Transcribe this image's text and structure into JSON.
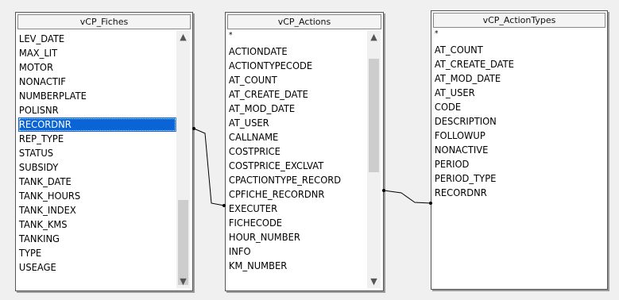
{
  "tables": [
    {
      "title": "vCP_Fiches",
      "fields": [
        "LEV_DATE",
        "MAX_LIT",
        "MOTOR",
        "NONACTIF",
        "NUMBERPLATE",
        "POLISNR",
        "RECORDNR",
        "REP_TYPE",
        "STATUS",
        "SUBSIDY",
        "TANK_DATE",
        "TANK_HOURS",
        "TANK_INDEX",
        "TANK_KMS",
        "TANKING",
        "TYPE",
        "USEAGE"
      ],
      "selected": "RECORDNR"
    },
    {
      "title": "vCP_Actions",
      "fields": [
        "*",
        "ACTIONDATE",
        "ACTIONTYPECODE",
        "AT_COUNT",
        "AT_CREATE_DATE",
        "AT_MOD_DATE",
        "AT_USER",
        "CALLNAME",
        "COSTPRICE",
        "COSTPRICE_EXCLVAT",
        "CPACTIONTYPE_RECORD",
        "CPFICHE_RECORDNR",
        "EXECUTER",
        "FICHECODE",
        "HOUR_NUMBER",
        "INFO",
        "KM_NUMBER"
      ]
    },
    {
      "title": "vCP_ActionTypes",
      "fields": [
        "*",
        "AT_COUNT",
        "AT_CREATE_DATE",
        "AT_MOD_DATE",
        "AT_USER",
        "CODE",
        "DESCRIPTION",
        "FOLLOWUP",
        "NONACTIVE",
        "PERIOD",
        "PERIOD_TYPE",
        "RECORDNR"
      ]
    }
  ],
  "icons": {
    "scroll_up": "▲",
    "scroll_down": "▼"
  },
  "colors": {
    "selection": "#0a64d6",
    "background": "#f0f0f0"
  }
}
